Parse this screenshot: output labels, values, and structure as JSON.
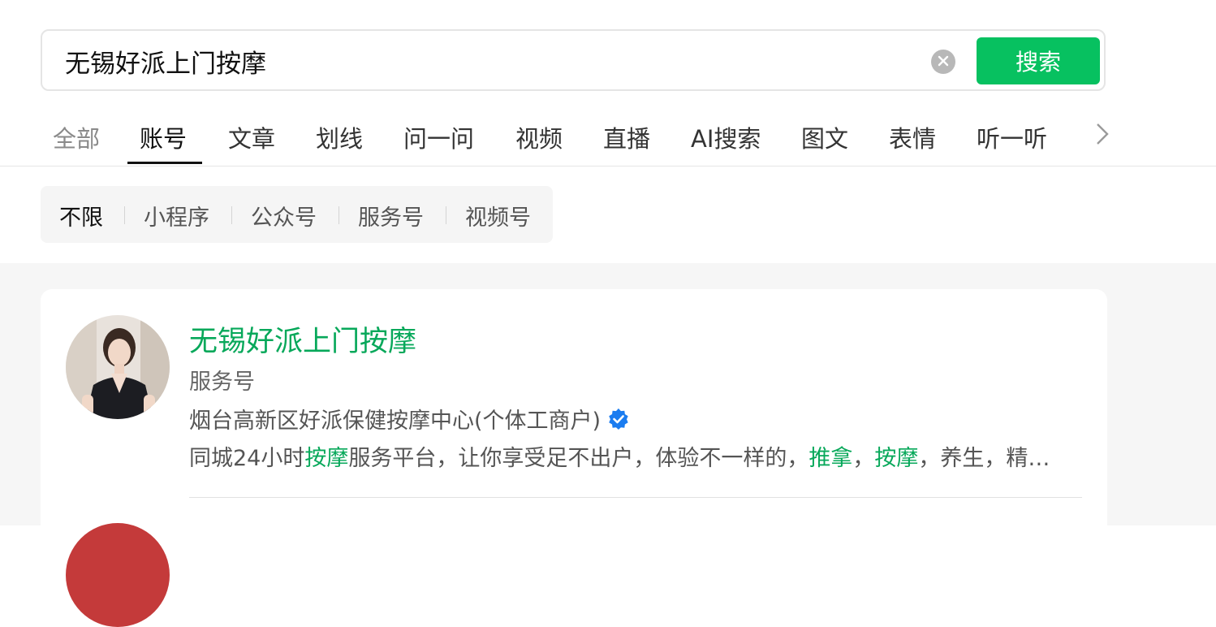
{
  "search": {
    "query": "无锡好派上门按摩",
    "button_label": "搜索"
  },
  "tabs": [
    {
      "label": "全部"
    },
    {
      "label": "账号"
    },
    {
      "label": "文章"
    },
    {
      "label": "划线"
    },
    {
      "label": "问一问"
    },
    {
      "label": "视频"
    },
    {
      "label": "直播"
    },
    {
      "label": "AI搜索"
    },
    {
      "label": "图文"
    },
    {
      "label": "表情"
    },
    {
      "label": "听一听"
    }
  ],
  "active_tab": "账号",
  "filters": [
    {
      "label": "不限"
    },
    {
      "label": "小程序"
    },
    {
      "label": "公众号"
    },
    {
      "label": "服务号"
    },
    {
      "label": "视频号"
    }
  ],
  "active_filter": "不限",
  "result": {
    "title": "无锡好派上门按摩",
    "type": "服务号",
    "org": "烟台高新区好派保健按摩中心(个体工商户)",
    "desc_parts": [
      "同城24小时",
      "按摩",
      "服务平台，让你享受足不出户，体验不一样的，",
      "推拿",
      "，",
      "按摩",
      "，养生，精…"
    ]
  },
  "colors": {
    "accent": "#07c160",
    "highlight": "#07a85a",
    "verified": "#1a7cf0"
  },
  "icons": {
    "clear": "clear-icon",
    "more": "chevron-right-icon",
    "verified": "verified-badge-icon"
  }
}
